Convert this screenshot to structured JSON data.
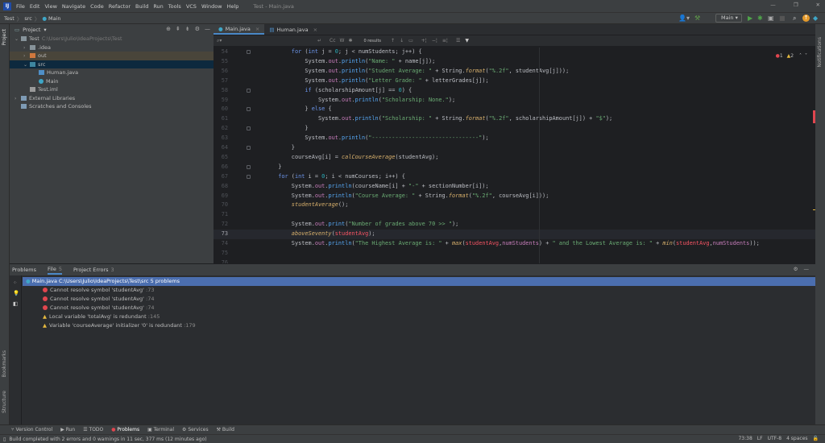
{
  "menubar": {
    "items": [
      "File",
      "Edit",
      "View",
      "Navigate",
      "Code",
      "Refactor",
      "Build",
      "Run",
      "Tools",
      "VCS",
      "Window",
      "Help"
    ],
    "window_title": "Test - Main.java"
  },
  "navbar": {
    "crumbs": [
      "Test",
      "src",
      "Main"
    ],
    "run_config": "Main"
  },
  "left_strip": {
    "project": "Project",
    "bookmarks": "Bookmarks",
    "structure": "Structure"
  },
  "right_strip": {
    "notifications": "Notifications"
  },
  "project": {
    "title": "Project",
    "tree": [
      {
        "label": "Test",
        "path": "C:\\Users\\Julio\\IdeaProjects\\Test",
        "depth": 0,
        "arrow": "v",
        "icon": "folder",
        "color": "#87939a"
      },
      {
        "label": ".idea",
        "depth": 1,
        "arrow": ">",
        "icon": "folder",
        "color": "#87939a"
      },
      {
        "label": "out",
        "depth": 1,
        "arrow": ">",
        "icon": "folder",
        "color": "#d0783d",
        "row": "excluded"
      },
      {
        "label": "src",
        "depth": 1,
        "arrow": "v",
        "icon": "folder",
        "color": "#3e86a0",
        "row": "selected"
      },
      {
        "label": "Human.java",
        "depth": 2,
        "arrow": "",
        "icon": "file",
        "color": "#4f8fc7"
      },
      {
        "label": "Main",
        "depth": 2,
        "arrow": "",
        "icon": "class",
        "color": "#3ea6c7"
      },
      {
        "label": "Test.iml",
        "depth": 1,
        "arrow": "",
        "icon": "file",
        "color": "#9a9a9a"
      },
      {
        "label": "External Libraries",
        "depth": 0,
        "arrow": ">",
        "icon": "lib",
        "color": "#7e9bb5"
      },
      {
        "label": "Scratches and Consoles",
        "depth": 0,
        "arrow": "",
        "icon": "scratch",
        "color": "#7e9bb5"
      }
    ]
  },
  "editor": {
    "tabs": [
      "Main.java",
      "Human.java"
    ],
    "find": {
      "results": "0 results",
      "cc": "Cc",
      "w": "W"
    },
    "inspection": {
      "errors": "1",
      "warnings": "2"
    },
    "current_line": "73",
    "lines": [
      {
        "n": "54",
        "i": 12,
        "t": [
          [
            "for",
            "kw"
          ],
          [
            " (",
            "pl"
          ],
          [
            "int",
            "kw"
          ],
          [
            " j = ",
            "pl"
          ],
          [
            "0",
            "num2"
          ],
          [
            "; j < numStudents; j++) {",
            "pl"
          ]
        ]
      },
      {
        "n": "55",
        "i": 16,
        "t": [
          [
            "System.",
            "pl"
          ],
          [
            "out",
            "fld"
          ],
          [
            ".",
            "pl"
          ],
          [
            "println",
            "mth"
          ],
          [
            "(",
            "pl"
          ],
          [
            "\"Name: \"",
            "str"
          ],
          [
            " + name[j]);",
            "pl"
          ]
        ]
      },
      {
        "n": "56",
        "i": 16,
        "t": [
          [
            "System.",
            "pl"
          ],
          [
            "out",
            "fld"
          ],
          [
            ".",
            "pl"
          ],
          [
            "println",
            "mth"
          ],
          [
            "(",
            "pl"
          ],
          [
            "\"Student Average: \"",
            "str"
          ],
          [
            " + String.",
            "pl"
          ],
          [
            "format",
            "it"
          ],
          [
            "(",
            "pl"
          ],
          [
            "\"%.2f\"",
            "str"
          ],
          [
            ", studentAvg[j]));",
            "pl"
          ]
        ]
      },
      {
        "n": "57",
        "i": 16,
        "t": [
          [
            "System.",
            "pl"
          ],
          [
            "out",
            "fld"
          ],
          [
            ".",
            "pl"
          ],
          [
            "println",
            "mth"
          ],
          [
            "(",
            "pl"
          ],
          [
            "\"Letter Grade: \"",
            "str"
          ],
          [
            " + letterGrades[j]);",
            "pl"
          ]
        ]
      },
      {
        "n": "58",
        "i": 16,
        "t": [
          [
            "if",
            "kw"
          ],
          [
            " (scholarshipAmount[j] == ",
            "pl"
          ],
          [
            "0",
            "num2"
          ],
          [
            ") {",
            "pl"
          ]
        ]
      },
      {
        "n": "59",
        "i": 20,
        "t": [
          [
            "System.",
            "pl"
          ],
          [
            "out",
            "fld"
          ],
          [
            ".",
            "pl"
          ],
          [
            "println",
            "mth"
          ],
          [
            "(",
            "pl"
          ],
          [
            "\"Scholarship: None.\"",
            "str"
          ],
          [
            ");",
            "pl"
          ]
        ]
      },
      {
        "n": "60",
        "i": 16,
        "t": [
          [
            "} ",
            "pl"
          ],
          [
            "else",
            "kw"
          ],
          [
            " {",
            "pl"
          ]
        ]
      },
      {
        "n": "61",
        "i": 20,
        "t": [
          [
            "System.",
            "pl"
          ],
          [
            "out",
            "fld"
          ],
          [
            ".",
            "pl"
          ],
          [
            "println",
            "mth"
          ],
          [
            "(",
            "pl"
          ],
          [
            "\"Scholarship: \"",
            "str"
          ],
          [
            " + String.",
            "pl"
          ],
          [
            "format",
            "it"
          ],
          [
            "(",
            "pl"
          ],
          [
            "\"%.2f\"",
            "str"
          ],
          [
            ", scholarshipAmount[j]) + ",
            "pl"
          ],
          [
            "\"$\"",
            "str"
          ],
          [
            ");",
            "pl"
          ]
        ]
      },
      {
        "n": "62",
        "i": 16,
        "t": [
          [
            "}",
            "pl"
          ]
        ]
      },
      {
        "n": "63",
        "i": 16,
        "t": [
          [
            "System.",
            "pl"
          ],
          [
            "out",
            "fld"
          ],
          [
            ".",
            "pl"
          ],
          [
            "println",
            "mth"
          ],
          [
            "(",
            "pl"
          ],
          [
            "\"--------------------------------\"",
            "str"
          ],
          [
            ");",
            "pl"
          ]
        ]
      },
      {
        "n": "64",
        "i": 12,
        "t": [
          [
            "}",
            "pl"
          ]
        ]
      },
      {
        "n": "65",
        "i": 12,
        "t": [
          [
            "courseAvg[i] = ",
            "pl"
          ],
          [
            "calCourseAverage",
            "it"
          ],
          [
            "(studentAvg);",
            "pl"
          ]
        ]
      },
      {
        "n": "66",
        "i": 8,
        "t": [
          [
            "}",
            "pl"
          ]
        ]
      },
      {
        "n": "67",
        "i": 8,
        "t": [
          [
            "for",
            "kw"
          ],
          [
            " (",
            "pl"
          ],
          [
            "int",
            "kw"
          ],
          [
            " i = ",
            "pl"
          ],
          [
            "0",
            "num2"
          ],
          [
            "; i < numCourses; i++) {",
            "pl"
          ]
        ]
      },
      {
        "n": "68",
        "i": 12,
        "t": [
          [
            "System.",
            "pl"
          ],
          [
            "out",
            "fld"
          ],
          [
            ".",
            "pl"
          ],
          [
            "println",
            "mth"
          ],
          [
            "(courseName[i] + ",
            "pl"
          ],
          [
            "\"-\"",
            "str"
          ],
          [
            " + sectionNumber[i]);",
            "pl"
          ]
        ]
      },
      {
        "n": "69",
        "i": 12,
        "t": [
          [
            "System.",
            "pl"
          ],
          [
            "out",
            "fld"
          ],
          [
            ".",
            "pl"
          ],
          [
            "println",
            "mth"
          ],
          [
            "(",
            "pl"
          ],
          [
            "\"Course Average: \"",
            "str"
          ],
          [
            " + String.",
            "pl"
          ],
          [
            "format",
            "it"
          ],
          [
            "(",
            "pl"
          ],
          [
            "\"%.2f\"",
            "str"
          ],
          [
            ", courseAvg[i]));",
            "pl"
          ]
        ]
      },
      {
        "n": "70",
        "i": 12,
        "t": [
          [
            "studentAverage",
            "it"
          ],
          [
            "();",
            "pl"
          ]
        ]
      },
      {
        "n": "71",
        "i": 0,
        "t": []
      },
      {
        "n": "72",
        "i": 12,
        "t": [
          [
            "System.",
            "pl"
          ],
          [
            "out",
            "fld"
          ],
          [
            ".",
            "pl"
          ],
          [
            "print",
            "mth"
          ],
          [
            "(",
            "pl"
          ],
          [
            "\"Number of grades above 70 >> \"",
            "str"
          ],
          [
            ");",
            "pl"
          ]
        ]
      },
      {
        "n": "73",
        "i": 12,
        "t": [
          [
            "aboveSeventy",
            "it"
          ],
          [
            "(",
            "pl"
          ],
          [
            "studentAvg",
            "err"
          ],
          [
            ");",
            "pl"
          ]
        ]
      },
      {
        "n": "74",
        "i": 12,
        "t": [
          [
            "System.",
            "pl"
          ],
          [
            "out",
            "fld"
          ],
          [
            ".",
            "pl"
          ],
          [
            "println",
            "mth"
          ],
          [
            "(",
            "pl"
          ],
          [
            "\"The Highest Average is: \"",
            "str"
          ],
          [
            " + ",
            "pl"
          ],
          [
            "max",
            "it"
          ],
          [
            "(",
            "pl"
          ],
          [
            "studentAvg",
            "err"
          ],
          [
            ",",
            "pl"
          ],
          [
            "numStudents",
            "fld"
          ],
          [
            ") + ",
            "pl"
          ],
          [
            "\" and the Lowest Average is: \"",
            "str"
          ],
          [
            " + ",
            "pl"
          ],
          [
            "min",
            "it"
          ],
          [
            "(",
            "pl"
          ],
          [
            "studentAvg",
            "err"
          ],
          [
            ",",
            "pl"
          ],
          [
            "numStudents",
            "fld"
          ],
          [
            "));",
            "pl"
          ]
        ]
      },
      {
        "n": "75",
        "i": 0,
        "t": []
      },
      {
        "n": "76",
        "i": 0,
        "t": []
      }
    ]
  },
  "problems": {
    "tabs": [
      {
        "label": "Problems",
        "count": ""
      },
      {
        "label": "File",
        "count": "5"
      },
      {
        "label": "Project Errors",
        "count": "3"
      }
    ],
    "header": {
      "file": "Main.java",
      "path": "C:\\Users\\Julio\\IdeaProjects\\Test\\src",
      "summary": "5 problems"
    },
    "items": [
      {
        "severity": "error",
        "text": "Cannot resolve symbol 'studentAvg'",
        "loc": ":73"
      },
      {
        "severity": "error",
        "text": "Cannot resolve symbol 'studentAvg'",
        "loc": ":74"
      },
      {
        "severity": "error",
        "text": "Cannot resolve symbol 'studentAvg'",
        "loc": ":74"
      },
      {
        "severity": "warning",
        "text": "Local variable 'totalAvg' is redundant",
        "loc": ":145"
      },
      {
        "severity": "warning",
        "text": "Variable 'courseAverage' initializer '0' is redundant",
        "loc": ":179"
      }
    ]
  },
  "toolwindows": [
    {
      "label": "Version Control",
      "icon": "⑂"
    },
    {
      "label": "Run",
      "icon": "▶"
    },
    {
      "label": "TODO",
      "icon": "☰"
    },
    {
      "label": "Problems",
      "icon": "●",
      "active": true
    },
    {
      "label": "Terminal",
      "icon": "▣"
    },
    {
      "label": "Services",
      "icon": "⚙"
    },
    {
      "label": "Build",
      "icon": "⚒"
    }
  ],
  "status": {
    "message": "Build completed with 2 errors and 0 warnings in 11 sec, 377 ms (12 minutes ago)",
    "position": "73:38",
    "line_sep": "LF",
    "encoding": "UTF-8",
    "indent": "4 spaces"
  },
  "colors": {
    "accent": "#4a88c7",
    "error": "#e0464f",
    "warning": "#e5b93f",
    "selection": "#4b6eaf"
  }
}
